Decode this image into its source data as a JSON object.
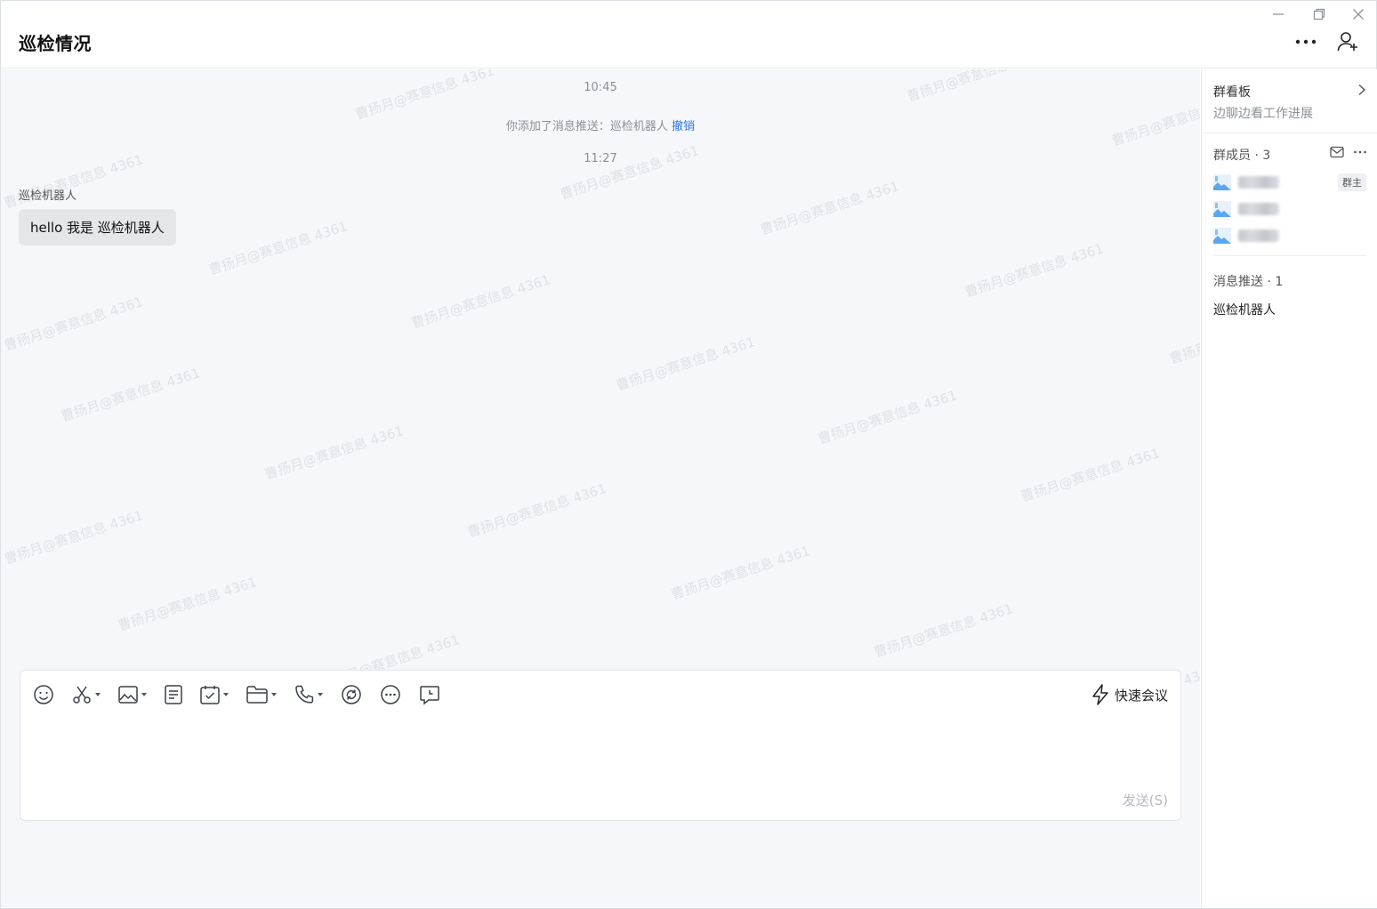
{
  "window": {
    "title": "巡检情况",
    "controls": [
      "minimize",
      "restore",
      "close"
    ]
  },
  "header": {
    "more_icon": "more-horizontal-icon",
    "add_member_icon": "add-user-icon"
  },
  "chat": {
    "watermark_text": "曹扬月@赛意信息 4361",
    "timestamps": [
      "10:45",
      "11:27"
    ],
    "system_message": {
      "text": "你添加了消息推送：巡检机器人",
      "action": "撤销"
    },
    "messages": [
      {
        "sender": "巡检机器人",
        "text": "hello 我是 巡检机器人"
      }
    ]
  },
  "composer": {
    "tools": [
      {
        "name": "emoji-icon",
        "dropdown": false
      },
      {
        "name": "scissors-icon",
        "dropdown": true
      },
      {
        "name": "image-icon",
        "dropdown": true
      },
      {
        "name": "document-icon",
        "dropdown": false
      },
      {
        "name": "calendar-check-icon",
        "dropdown": true
      },
      {
        "name": "folder-icon",
        "dropdown": true
      },
      {
        "name": "phone-icon",
        "dropdown": true
      },
      {
        "name": "sync-icon",
        "dropdown": false
      },
      {
        "name": "more-circle-icon",
        "dropdown": false
      },
      {
        "name": "message-clock-icon",
        "dropdown": false
      }
    ],
    "quick_meeting_label": "快速会议",
    "input_value": "",
    "send_label": "发送(S)"
  },
  "side": {
    "board_title": "群看板",
    "board_subtitle": "边聊边看工作进展",
    "members_title": "群成员 · 3",
    "owner_tag": "群主",
    "push_title": "消息推送 · 1",
    "push_items": [
      "巡检机器人"
    ]
  },
  "colors": {
    "accent_link": "#2e73e8",
    "chat_bg": "#f6f7fa",
    "bubble_bg": "#e4e6ea",
    "avatar_blue": "#5aa7f0"
  }
}
